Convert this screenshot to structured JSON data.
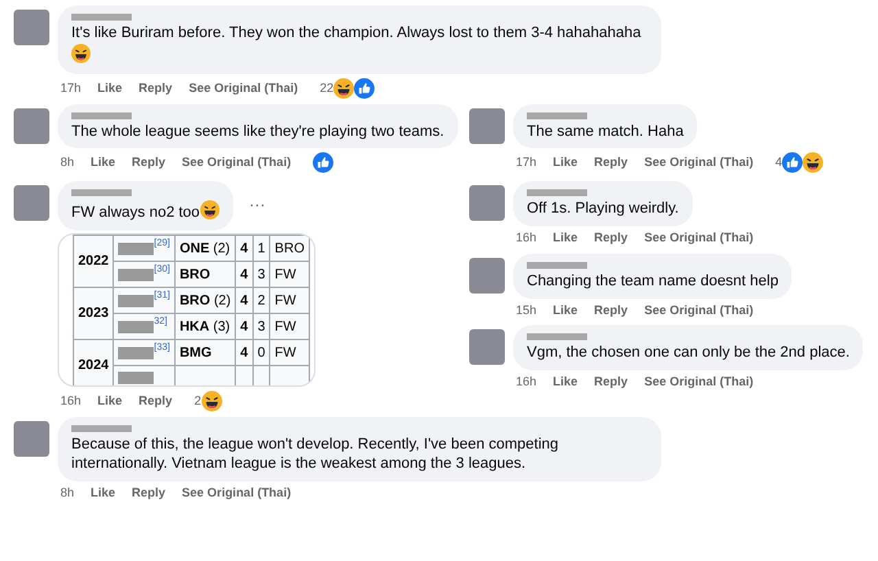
{
  "top_comment": {
    "text": "It's like Buriram before. They won the champion. Always lost to them 3-4 hahahahaha",
    "emoji": {
      "kind": "haha"
    },
    "time": "17h",
    "actions": [
      "Like",
      "Reply",
      "See Original (Thai)"
    ],
    "reaction_count": "22",
    "reactions": [
      {
        "kind": "haha"
      },
      {
        "kind": "like"
      }
    ]
  },
  "left_comments": [
    {
      "text": "The whole league seems like they're playing two teams.",
      "time": "8h",
      "actions": [
        "Like",
        "Reply",
        "See Original (Thai)"
      ],
      "reactions": [
        {
          "kind": "like"
        }
      ]
    },
    {
      "text": "FW always no2 too",
      "emoji": {
        "kind": "haha"
      },
      "more": "···",
      "time": "16h",
      "actions": [
        "Like",
        "Reply"
      ],
      "reaction_count": "2",
      "reactions": [
        {
          "kind": "haha"
        }
      ],
      "table": [
        {
          "year": "2022",
          "rows": [
            {
              "ref": "[29]",
              "team": "ONE",
              "extra": "(2)",
              "column_4": "4",
              "column_5": "1",
              "column_6": "BRO"
            },
            {
              "ref": "[30]",
              "team": "BRO",
              "column_4": "4",
              "column_5": "3",
              "column_6": "FW"
            }
          ]
        },
        {
          "year": "2023",
          "rows": [
            {
              "ref": "[31]",
              "team": "BRO",
              "extra": "(2)",
              "column_4": "4",
              "column_5": "2",
              "column_6": "FW"
            },
            {
              "ref": "32]",
              "team": "HKA",
              "extra": "(3)",
              "column_4": "4",
              "column_5": "3",
              "column_6": "FW"
            }
          ]
        },
        {
          "year": "2024",
          "rows": [
            {
              "ref": "[33]",
              "team": "BMG",
              "column_4": "4",
              "column_5": "0",
              "column_6": "FW"
            },
            {}
          ]
        }
      ]
    }
  ],
  "right_comments": [
    {
      "text": "The same match. Haha",
      "time": "17h",
      "actions": [
        "Like",
        "Reply",
        "See Original (Thai)"
      ],
      "reaction_count": "4",
      "reactions": [
        {
          "kind": "like"
        },
        {
          "kind": "haha"
        }
      ]
    },
    {
      "text": "Off 1s. Playing weirdly.",
      "time": "16h",
      "actions": [
        "Like",
        "Reply",
        "See Original (Thai)"
      ]
    },
    {
      "text": "Changing the team name doesnt help",
      "time": "15h",
      "actions": [
        "Like",
        "Reply",
        "See Original (Thai)"
      ]
    },
    {
      "text": "Vgm, the chosen one can only be the 2nd place.",
      "time": "16h",
      "actions": [
        "Like",
        "Reply",
        "See Original (Thai)"
      ]
    }
  ],
  "bottom_comment": {
    "text": "Because of this, the league won't develop. Recently, I've been competing internationally. Vietnam league is the weakest among the 3 leagues.",
    "time": "8h",
    "actions": [
      "Like",
      "Reply",
      "See Original (Thai)"
    ]
  }
}
